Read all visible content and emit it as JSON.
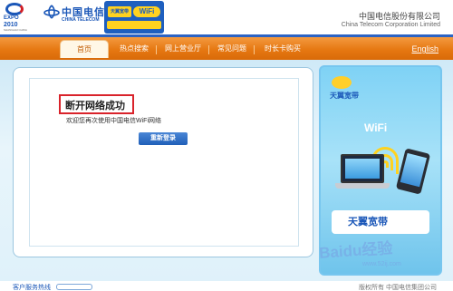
{
  "header": {
    "expo_logo": {
      "line1": "EXPO",
      "line2": "2010",
      "line3": "SHANGHAI CHINA",
      "icon": "expo-logo-icon"
    },
    "ct_logo": {
      "cn": "中国电信",
      "en": "CHINA TELECOM",
      "icon": "china-telecom-logo-icon"
    },
    "wifi_logo": {
      "cn": "天翼宽带",
      "en": "WiFi",
      "icon": "wifi-logo-icon"
    },
    "corp_cn": "中国电信股份有限公司",
    "corp_en": "China Telecom Corporation Limited"
  },
  "nav": {
    "tabs": [
      {
        "label": "首页",
        "active": true
      },
      {
        "label": "热点搜索",
        "active": false
      },
      {
        "label": "网上营业厅",
        "active": false
      },
      {
        "label": "常见问题",
        "active": false
      },
      {
        "label": "时长卡购买",
        "active": false
      }
    ],
    "language_link": "English"
  },
  "main": {
    "title": "断开网络成功",
    "welcome": "欢迎您再次使用中国电信WiFi网络",
    "relogin_button": "重新登录"
  },
  "ad": {
    "brand": "天翼宽带",
    "wifi_label": "WiFi",
    "banner": "天翼宽带",
    "icons": [
      "cloud-icon",
      "wifi-signal-icon",
      "laptop-icon",
      "phone-icon"
    ]
  },
  "footer": {
    "hotline": "客户服务热线",
    "copyright": "版权所有 中国电信集团公司"
  },
  "watermark": {
    "text": "Baidu经验",
    "sub": "www.52ij.com"
  },
  "colors": {
    "nav_orange": "#e67812",
    "brand_blue": "#1b57b8",
    "alert_red": "#d9232b",
    "panel_blue": "#9cc7e0"
  }
}
